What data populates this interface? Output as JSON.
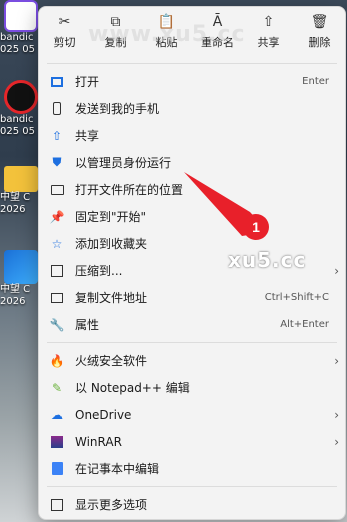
{
  "desktop": {
    "icons": [
      {
        "label": "bandic",
        "sub": "025 05"
      },
      {
        "label": "bandic",
        "sub": "025 05"
      },
      {
        "label": "中望 C",
        "sub": "2026"
      },
      {
        "label": "中望 C",
        "sub": "2026"
      }
    ]
  },
  "toolbar": {
    "cut": "剪切",
    "copy": "复制",
    "paste": "粘贴",
    "rename": "重命名",
    "share": "共享",
    "delete": "删除"
  },
  "menu": {
    "open": {
      "label": "打开",
      "shortcut": "Enter"
    },
    "send_phone": {
      "label": "发送到我的手机"
    },
    "share": {
      "label": "共享"
    },
    "run_admin": {
      "label": "以管理员身份运行"
    },
    "open_location": {
      "label": "打开文件所在的位置"
    },
    "pin_start": {
      "label": "固定到\"开始\""
    },
    "add_fav": {
      "label": "添加到收藏夹"
    },
    "compress": {
      "label": "压缩到..."
    },
    "copy_path": {
      "label": "复制文件地址",
      "shortcut": "Ctrl+Shift+C"
    },
    "properties": {
      "label": "属性",
      "shortcut": "Alt+Enter"
    },
    "huorong": {
      "label": "火绒安全软件"
    },
    "notepadpp": {
      "label": "以 Notepad++ 编辑"
    },
    "onedrive": {
      "label": "OneDrive"
    },
    "winrar": {
      "label": "WinRAR"
    },
    "notepad": {
      "label": "在记事本中编辑"
    },
    "more": {
      "label": "显示更多选项"
    }
  },
  "annotation": {
    "number": "1",
    "color": "#e8202a"
  },
  "watermarks": {
    "top": "www.xu5.cc",
    "mid": "xu5.cc"
  }
}
